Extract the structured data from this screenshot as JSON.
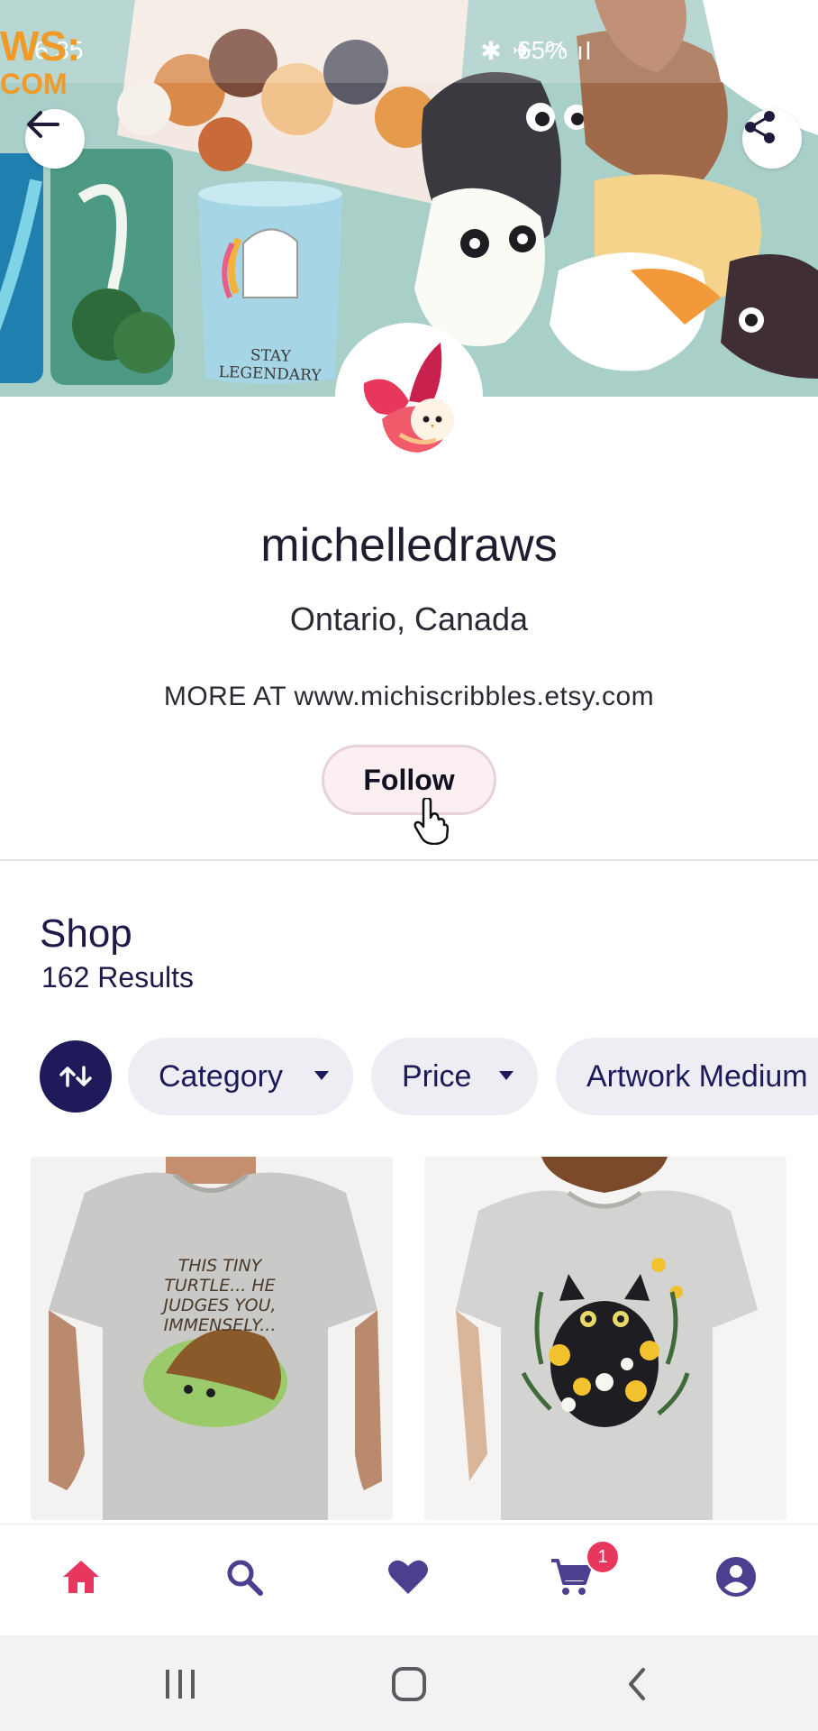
{
  "status_bar": {
    "time": "6:35",
    "battery": "65%",
    "signal_icons": "✱ ✈ ◠ ıl"
  },
  "banner": {
    "fragment_line1": "WS:",
    "fragment_line2": "COM",
    "mug_text": "STAY LEGENDARY"
  },
  "profile": {
    "name": "michelledraws",
    "location": "Ontario, Canada",
    "bio": "MORE AT www.michiscribbles.etsy.com",
    "follow_label": "Follow"
  },
  "shop": {
    "title": "Shop",
    "results": "162 Results",
    "filters": [
      "Category",
      "Price",
      "Artwork Medium"
    ]
  },
  "products": [
    {
      "shirt_text": "THIS TINY TURTLE... HE JUDGES YOU, IMMENSELY..."
    },
    {
      "shirt_text": ""
    }
  ],
  "bottom_nav": {
    "items": [
      "home-icon",
      "search-icon",
      "heart-icon",
      "cart-icon",
      "account-icon"
    ],
    "cart_count": "1",
    "active_color": "#e8375c",
    "icon_color": "#4b3f8f"
  }
}
